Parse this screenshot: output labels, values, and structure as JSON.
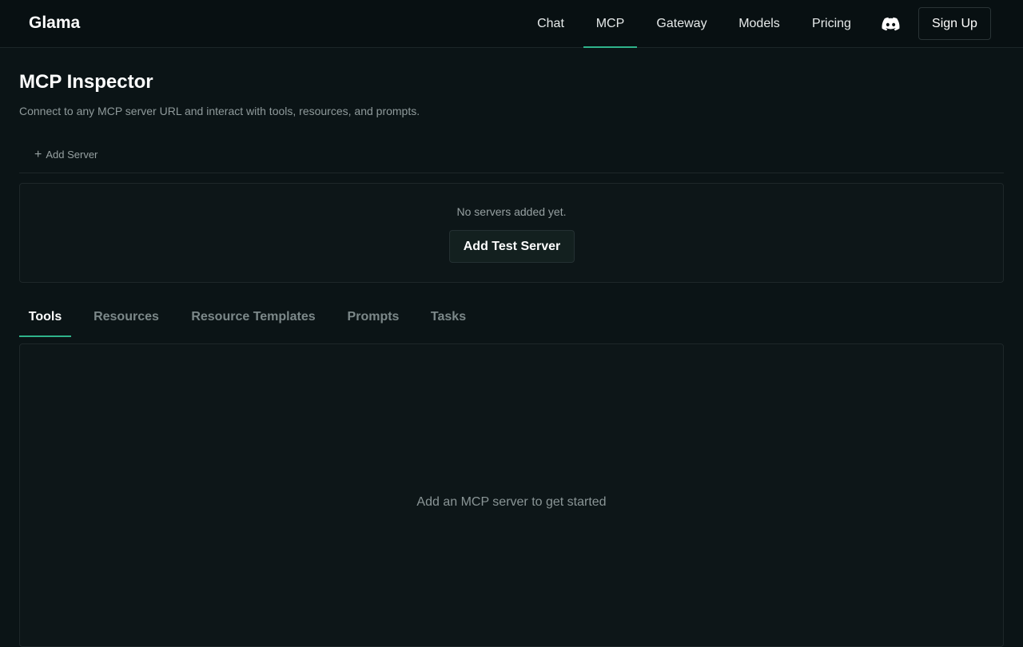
{
  "header": {
    "brand": "Glama",
    "nav": [
      {
        "label": "Chat",
        "active": false
      },
      {
        "label": "MCP",
        "active": true
      },
      {
        "label": "Gateway",
        "active": false
      },
      {
        "label": "Models",
        "active": false
      },
      {
        "label": "Pricing",
        "active": false
      }
    ],
    "discord_icon": "discord-icon",
    "signup_label": "Sign Up"
  },
  "main": {
    "title": "MCP Inspector",
    "description": "Connect to any MCP server URL and interact with tools, resources, and prompts.",
    "add_server_label": "Add Server",
    "servers_empty_text": "No servers added yet.",
    "add_test_server_label": "Add Test Server",
    "tabs": [
      {
        "label": "Tools",
        "active": true
      },
      {
        "label": "Resources",
        "active": false
      },
      {
        "label": "Resource Templates",
        "active": false
      },
      {
        "label": "Prompts",
        "active": false
      },
      {
        "label": "Tasks",
        "active": false
      }
    ],
    "content_empty_text": "Add an MCP server to get started"
  },
  "colors": {
    "background": "#0b1416",
    "accent": "#2fb38b"
  }
}
